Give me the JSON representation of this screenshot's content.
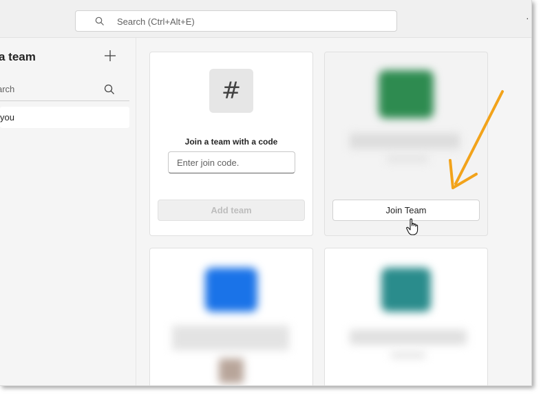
{
  "topbar": {
    "search_placeholder": "Search (Ctrl+Alt+E)",
    "more_label": "·",
    "icons": {
      "search": "search-icon",
      "more": "more-icon"
    }
  },
  "sidebar": {
    "title": "a team",
    "search_label": "arch",
    "item_label": "you",
    "icons": {
      "add": "plus-icon",
      "search": "search-icon"
    }
  },
  "join_code_card": {
    "icon_glyph": "#",
    "title": "Join a team with a code",
    "input_placeholder": "Enter join code.",
    "button_label": "Add team",
    "button_state": "disabled"
  },
  "team_card_1": {
    "button_label": "Join Team",
    "tile_color": "#2e8b50"
  },
  "team_card_2": {
    "tile_color": "#1a73e8"
  },
  "team_card_3": {
    "tile_color": "#2a8c8c"
  },
  "annotation": {
    "arrow_color": "#f2a31b"
  }
}
